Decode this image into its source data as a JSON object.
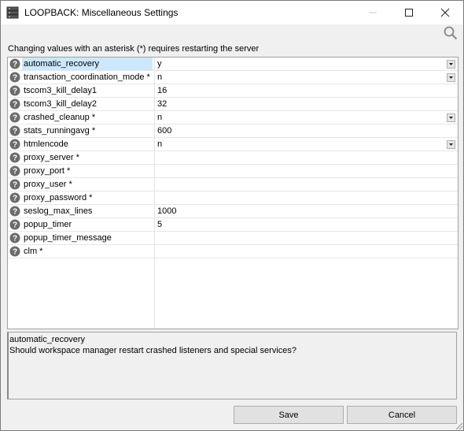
{
  "window": {
    "title": "LOOPBACK: Miscellaneous Settings"
  },
  "notice": "Changing values with an asterisk (*) requires restarting the server",
  "icons": {
    "app": "server-icon",
    "help": "question-icon",
    "search": "search-icon"
  },
  "settings": [
    {
      "name": "automatic_recovery",
      "value": "y",
      "dropdown": true,
      "selected": true
    },
    {
      "name": "transaction_coordination_mode *",
      "value": "n",
      "dropdown": true
    },
    {
      "name": "tscom3_kill_delay1",
      "value": "16"
    },
    {
      "name": "tscom3_kill_delay2",
      "value": "32"
    },
    {
      "name": "crashed_cleanup *",
      "value": "n",
      "dropdown": true
    },
    {
      "name": "stats_runningavg *",
      "value": "600"
    },
    {
      "name": "htmlencode",
      "value": "n",
      "dropdown": true
    },
    {
      "name": "proxy_server *",
      "value": ""
    },
    {
      "name": "proxy_port *",
      "value": ""
    },
    {
      "name": "proxy_user *",
      "value": ""
    },
    {
      "name": "proxy_password *",
      "value": ""
    },
    {
      "name": "seslog_max_lines",
      "value": "1000"
    },
    {
      "name": "popup_timer",
      "value": "5"
    },
    {
      "name": "popup_timer_message",
      "value": ""
    },
    {
      "name": "clm *",
      "value": ""
    }
  ],
  "description": {
    "title": "automatic_recovery",
    "text": "Should workspace manager restart crashed listeners and special services?"
  },
  "buttons": {
    "save": "Save",
    "cancel": "Cancel"
  }
}
